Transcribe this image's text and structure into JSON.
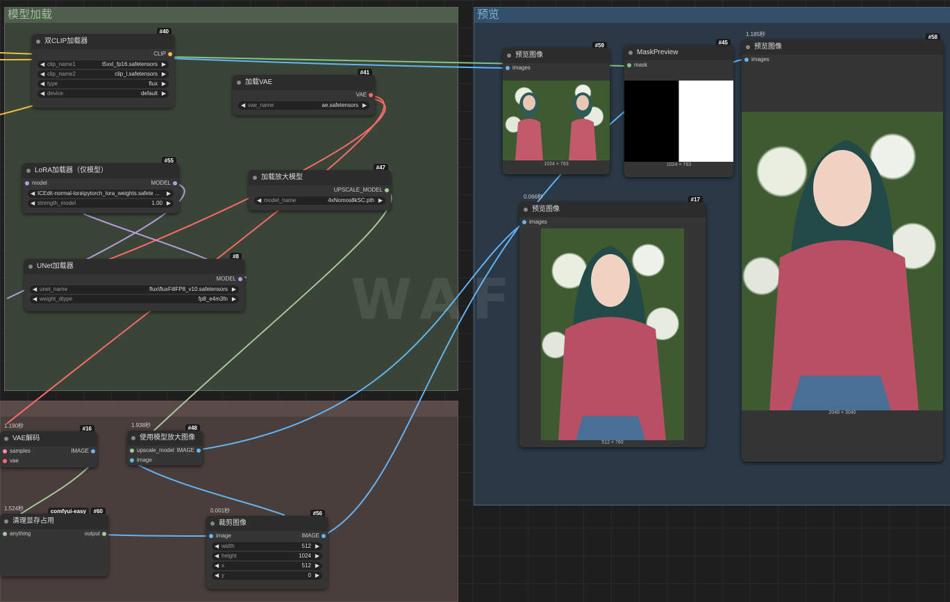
{
  "groups": {
    "model_loading": "模型加载",
    "preview": "预览",
    "bottom": ""
  },
  "watermark": "WAFOU",
  "nodes": {
    "dual_clip": {
      "title": "双CLIP加载器",
      "id": "#40",
      "output": "CLIP",
      "widgets": [
        {
          "label": "clip_name1",
          "value": "t5xxl_fp16.safetensors"
        },
        {
          "label": "clip_name2",
          "value": "clip_l.safetensors"
        },
        {
          "label": "type",
          "value": "flux"
        },
        {
          "label": "device",
          "value": "default"
        }
      ]
    },
    "vae_loader": {
      "title": "加载VAE",
      "id": "#41",
      "output": "VAE",
      "widgets": [
        {
          "label": "vae_name",
          "value": "ae.safetensors"
        }
      ]
    },
    "lora_loader": {
      "title": "LoRA加载器（仅模型）",
      "id": "#55",
      "input": "model",
      "output": "MODEL",
      "widgets": [
        {
          "label": "",
          "value": "ICEdit-normal-lora\\pytorch_lora_weights.safete ..."
        },
        {
          "label": "strength_model",
          "value": "1.00"
        }
      ]
    },
    "upscale_loader": {
      "title": "加载放大模型",
      "id": "#47",
      "output": "UPSCALE_MODEL",
      "widgets": [
        {
          "label": "model_name",
          "value": "4xNomos8kSC.pth"
        }
      ]
    },
    "unet_loader": {
      "title": "UNet加载器",
      "id": "#8",
      "output": "MODEL",
      "widgets": [
        {
          "label": "unet_name",
          "value": "flux\\fluxFillFP8_v10.safetensors"
        },
        {
          "label": "weight_dtype",
          "value": "fp8_e4m3fn"
        }
      ]
    },
    "preview59": {
      "title": "预览图像",
      "id": "#59",
      "input": "images",
      "dims": "1024 × 763"
    },
    "mask_preview": {
      "title": "MaskPreview",
      "id": "#45",
      "input": "mask",
      "dims": "1024 × 763"
    },
    "preview58": {
      "title": "预览图像",
      "id": "#58",
      "timing": "1.185秒",
      "input": "images",
      "dims": "2048 × 3040"
    },
    "preview17": {
      "title": "预览图像",
      "id": "#17",
      "timing": "0.066秒",
      "input": "images",
      "dims": "512 × 760"
    },
    "vae_decode": {
      "title": "VAE解码",
      "id": "#16",
      "timing": "1.190秒",
      "inputs": [
        "samples",
        "vae"
      ],
      "output": "IMAGE"
    },
    "upscale_image": {
      "title": "使用模型放大图像",
      "id": "#48",
      "timing": "1.938秒",
      "inputs": [
        "upscale_model",
        "image"
      ],
      "output": "IMAGE"
    },
    "clear_vram": {
      "title": "清理显存占用",
      "id": "#60",
      "tag": "comfyui-easy",
      "timing": "1.524秒",
      "input": "anything",
      "output": "output"
    },
    "crop_image": {
      "title": "裁剪图像",
      "id": "#56",
      "timing": "0.001秒",
      "input": "image",
      "output": "IMAGE",
      "widgets": [
        {
          "label": "width",
          "value": "512"
        },
        {
          "label": "height",
          "value": "1024"
        },
        {
          "label": "x",
          "value": "512"
        },
        {
          "label": "y",
          "value": "0"
        }
      ]
    }
  },
  "colors": {
    "clip": "#f0c040",
    "vae": "#ff6b6b",
    "model": "#b39ddb",
    "image": "#64b5f6",
    "upscale": "#a8c8a0",
    "mask": "#81c784"
  }
}
